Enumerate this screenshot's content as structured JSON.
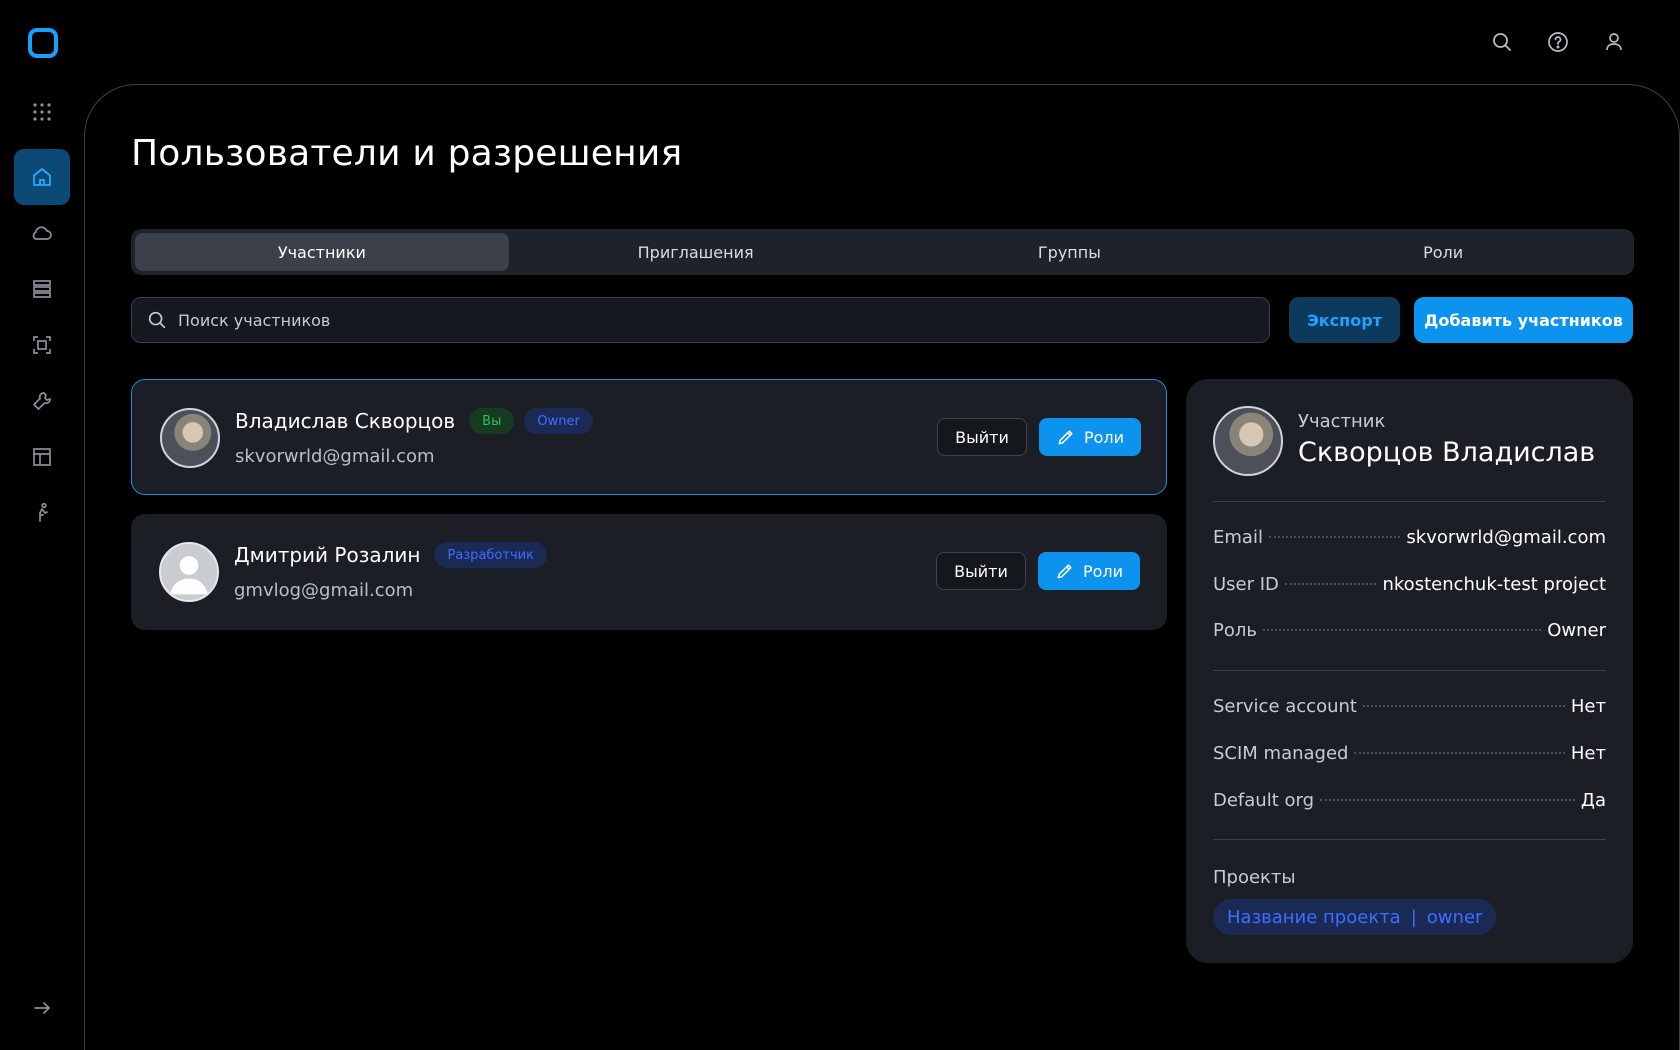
{
  "page": {
    "title": "Пользователи и разрешения"
  },
  "tabs": [
    {
      "label": "Участники",
      "active": true
    },
    {
      "label": "Приглашения",
      "active": false
    },
    {
      "label": "Группы",
      "active": false
    },
    {
      "label": "Роли",
      "active": false
    }
  ],
  "search": {
    "placeholder": "Поиск участников",
    "value": ""
  },
  "actions": {
    "export_label": "Экспорт",
    "add_label": "Добавить участников"
  },
  "members": [
    {
      "name": "Владислав Скворцов",
      "email": "skvorwrld@gmail.com",
      "badges": [
        "Вы",
        "Owner"
      ],
      "avatar": "photo",
      "leave_label": "Выйти",
      "roles_label": "Роли",
      "selected": true
    },
    {
      "name": "Дмитрий Розалин",
      "email": "gmvlog@gmail.com",
      "badges": [
        "Разработчик"
      ],
      "avatar": "generic-user",
      "leave_label": "Выйти",
      "roles_label": "Роли",
      "selected": false
    }
  ],
  "details": {
    "role_label": "Участник",
    "name": "Скворцов Владислав",
    "fields": [
      {
        "key": "Email",
        "value": "skvorwrld@gmail.com"
      },
      {
        "key": "User ID",
        "value": "nkostenchuk-test project"
      },
      {
        "key": "Роль",
        "value": "Owner"
      },
      {
        "key": "Service account",
        "value": "Нет"
      },
      {
        "key": "SCIM managed",
        "value": "Нет"
      },
      {
        "key": "Default org",
        "value": "Да"
      }
    ],
    "projects_label": "Проекты",
    "project": {
      "name": "Название проекта",
      "separator": "|",
      "role": "owner"
    }
  },
  "icons": {
    "logo": "app-logo",
    "top": [
      "search-icon",
      "help-icon",
      "user-icon"
    ],
    "rail": [
      "apps-grid-icon",
      "home-icon",
      "cloud-icon",
      "database-icon",
      "frame-icon",
      "tools-icon",
      "layout-icon",
      "person-icon"
    ],
    "collapse": "arrow-right-icon"
  },
  "colors": {
    "accent": "#0c93ee",
    "accent_dark": "#0c4a75",
    "badge_green": "#2fbf5a",
    "badge_blue": "#3f6dff",
    "panel": "#1b1e25",
    "background": "#000000"
  }
}
